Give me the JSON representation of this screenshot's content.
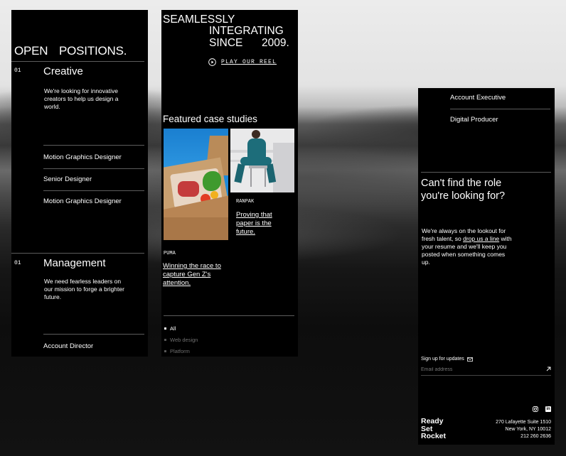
{
  "positions": {
    "title_word1": "OPEN",
    "title_word2": "POSITIONS.",
    "categories": [
      {
        "number": "01",
        "name": "Creative",
        "description": "We're looking for innovative creators to help us design a world.",
        "roles": [
          "Motion Graphics Designer",
          "Senior Designer",
          "Motion Graphics Designer"
        ]
      },
      {
        "number": "01",
        "name": "Management",
        "description": "We need fearless leaders on our mission to forge a brighter future.",
        "roles": [
          "Account Director"
        ]
      }
    ]
  },
  "hero": {
    "line1": "SEAMLESSLY",
    "line2": "INTEGRATING",
    "line3a": "SINCE",
    "line3b": "2009.",
    "reel_label": "PLAY OUR REEL"
  },
  "featured": {
    "heading": "Featured case studies",
    "cases": [
      {
        "client": "PUMA",
        "title": "Winning the race to capture Gen Z's attention."
      },
      {
        "client": "RANPAK",
        "title": "Proving that paper is the future."
      }
    ],
    "filters": [
      {
        "label": "All",
        "active": true
      },
      {
        "label": "Web design",
        "active": false
      },
      {
        "label": "Platform",
        "active": false
      }
    ]
  },
  "more_roles": {
    "roles": [
      "Account Executive",
      "Digital Producer"
    ],
    "cta_line1": "Can't find the role",
    "cta_line2": "you're looking for?",
    "body_before": "We're always on the lookout for fresh talent, so ",
    "body_link": "drop us a line",
    "body_after": " with your resume and we'll keep you posted when something comes up."
  },
  "footer": {
    "signup_label": "Sign up for updates",
    "email_placeholder": "Email address",
    "logo_lines": [
      "Ready",
      "Set",
      "Rocket"
    ],
    "address_lines": [
      "270 Lafayette Suite 1510",
      "New York, NY 10012",
      "212 260 2636"
    ]
  },
  "colors": {
    "panel_bg": "#000000",
    "text": "#ffffff",
    "rule": "#5c5c5c",
    "muted": "#7a7a7a",
    "puma_sky": "#1f8ad9",
    "ranpak_bg": "#e9e9ea"
  }
}
